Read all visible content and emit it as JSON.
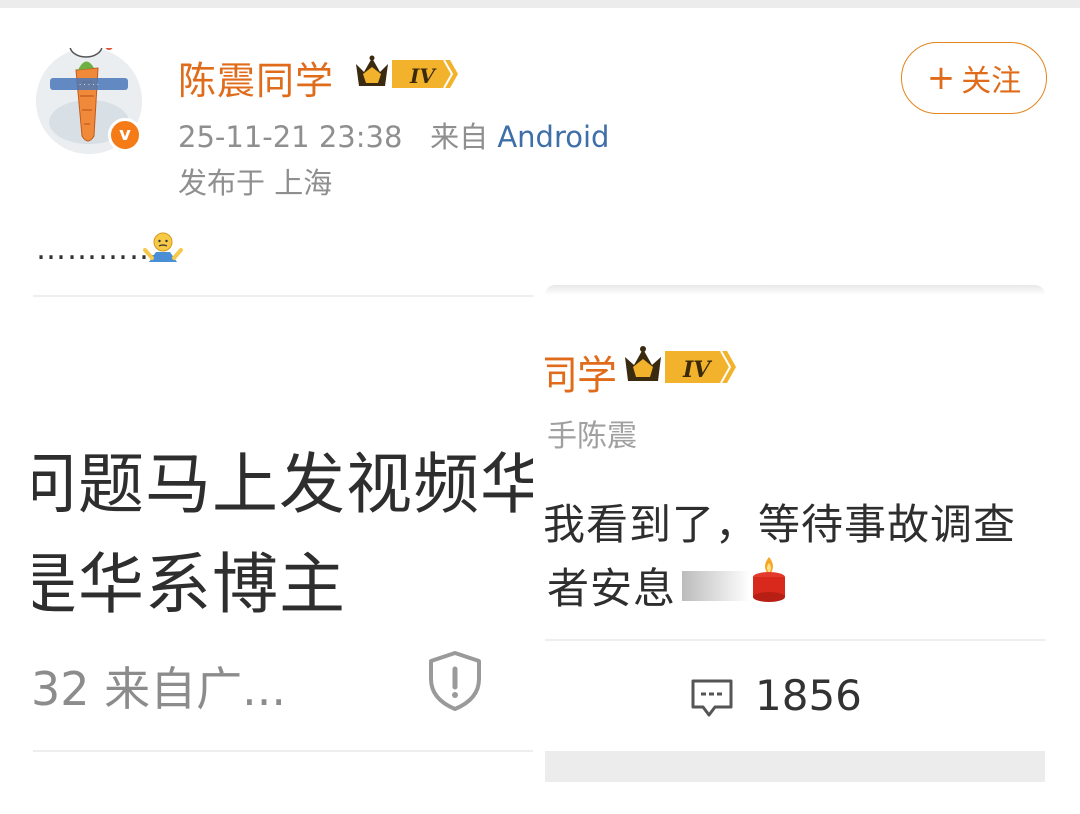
{
  "post": {
    "author": "陈震同学",
    "level_badge": "IV",
    "timestamp": "25-11-21 23:38",
    "source_prefix": "来自",
    "source": "Android",
    "location": "发布于 上海",
    "follow_label": "关注",
    "follow_plus": "+",
    "verified_mark": "v",
    "text": "…………"
  },
  "left_screenshot": {
    "line1": "问题马上发视频华为",
    "line2": "是华系博主",
    "meta": "32  来自广..."
  },
  "right_screenshot": {
    "name": "同学",
    "level_badge": "IV",
    "subtitle": "手陈震",
    "line1": "我看到了，等待事故调查",
    "line2": "者安息",
    "comment_count": "1856"
  },
  "colors": {
    "accent": "#e06c1b",
    "link": "#3f6fa8",
    "muted": "#8f8f8f",
    "badge_gold": "#f3b22c"
  },
  "icons": [
    "crown-badge-icon",
    "shrug-emoji-icon",
    "shield-alert-icon",
    "candle-emoji-icon",
    "comment-icon"
  ]
}
